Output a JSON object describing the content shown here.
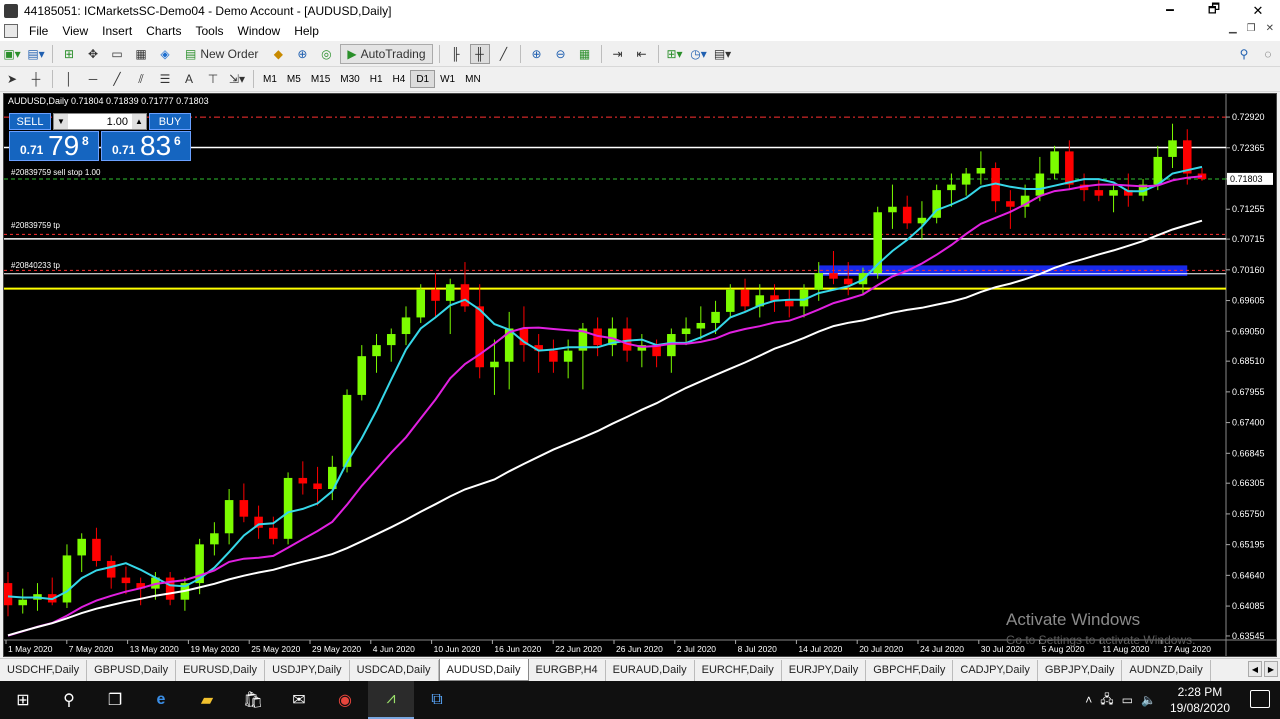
{
  "window": {
    "title": "44185051: ICMarketsSC-Demo04 - Demo Account - [AUDUSD,Daily]",
    "minimize": "🗕",
    "maximize": "🗗",
    "close": "✕"
  },
  "menu": {
    "items": [
      "File",
      "View",
      "Insert",
      "Charts",
      "Tools",
      "Window",
      "Help"
    ]
  },
  "toolbar": {
    "new_order_label": "New Order",
    "autotrading_label": "AutoTrading"
  },
  "drawing_tools": [
    "A"
  ],
  "timeframes": [
    "M1",
    "M5",
    "M15",
    "M30",
    "H1",
    "H4",
    "D1",
    "W1",
    "MN"
  ],
  "active_timeframe": "D1",
  "chart": {
    "symbol_line": "AUDUSD,Daily  0.71804 0.71839 0.71777 0.71803",
    "current_price": "0.71803",
    "colors": {
      "background": "#000000",
      "bull": "#7cfc00",
      "bear": "#ff0000",
      "ma_fast": "#36d7e8",
      "ma_mid": "#e020e0",
      "ma_slow": "#ffffff",
      "zone": "#1a2cff"
    }
  },
  "one_click": {
    "sell_label": "SELL",
    "buy_label": "BUY",
    "lot": "1.00",
    "sell_small": "0.71",
    "sell_big": "79",
    "sell_sup": "8",
    "buy_small": "0.71",
    "buy_big": "83",
    "buy_sup": "6"
  },
  "orders": [
    {
      "label": "#20839759 sell stop 1.00"
    },
    {
      "label": "#20839759 tp"
    },
    {
      "label": "#20840233 tp"
    }
  ],
  "watermark": {
    "line1": "Activate Windows",
    "line2": "Go to Settings to activate Windows."
  },
  "chart_data": {
    "type": "candlestick",
    "yticks": [
      "0.72920",
      "0.72365",
      "0.71803",
      "0.71255",
      "0.70715",
      "0.70160",
      "0.69605",
      "0.69050",
      "0.68510",
      "0.67955",
      "0.67400",
      "0.66845",
      "0.66305",
      "0.65750",
      "0.65195",
      "0.64640",
      "0.64085",
      "0.63545"
    ],
    "xticks": [
      "1 May 2020",
      "7 May 2020",
      "13 May 2020",
      "19 May 2020",
      "25 May 2020",
      "29 May 2020",
      "4 Jun 2020",
      "10 Jun 2020",
      "16 Jun 2020",
      "22 Jun 2020",
      "26 Jun 2020",
      "2 Jul 2020",
      "8 Jul 2020",
      "14 Jul 2020",
      "20 Jul 2020",
      "24 Jul 2020",
      "30 Jul 2020",
      "5 Aug 2020",
      "11 Aug 2020",
      "17 Aug 2020"
    ],
    "ylim": [
      0.6349,
      0.7312
    ],
    "ohlc": [
      [
        0.645,
        0.647,
        0.639,
        0.641
      ],
      [
        0.641,
        0.644,
        0.6395,
        0.642
      ],
      [
        0.642,
        0.645,
        0.64,
        0.643
      ],
      [
        0.643,
        0.646,
        0.641,
        0.6415
      ],
      [
        0.6415,
        0.652,
        0.6405,
        0.65
      ],
      [
        0.65,
        0.654,
        0.647,
        0.653
      ],
      [
        0.653,
        0.655,
        0.648,
        0.649
      ],
      [
        0.649,
        0.65,
        0.644,
        0.646
      ],
      [
        0.646,
        0.648,
        0.643,
        0.645
      ],
      [
        0.645,
        0.646,
        0.641,
        0.644
      ],
      [
        0.644,
        0.647,
        0.642,
        0.646
      ],
      [
        0.646,
        0.647,
        0.641,
        0.642
      ],
      [
        0.642,
        0.646,
        0.64,
        0.645
      ],
      [
        0.645,
        0.653,
        0.643,
        0.652
      ],
      [
        0.652,
        0.656,
        0.65,
        0.654
      ],
      [
        0.654,
        0.662,
        0.652,
        0.66
      ],
      [
        0.66,
        0.663,
        0.656,
        0.657
      ],
      [
        0.657,
        0.659,
        0.653,
        0.655
      ],
      [
        0.655,
        0.657,
        0.652,
        0.653
      ],
      [
        0.653,
        0.665,
        0.652,
        0.664
      ],
      [
        0.664,
        0.667,
        0.661,
        0.663
      ],
      [
        0.663,
        0.666,
        0.659,
        0.662
      ],
      [
        0.662,
        0.668,
        0.66,
        0.666
      ],
      [
        0.666,
        0.68,
        0.665,
        0.679
      ],
      [
        0.679,
        0.688,
        0.678,
        0.686
      ],
      [
        0.686,
        0.69,
        0.683,
        0.688
      ],
      [
        0.688,
        0.691,
        0.685,
        0.69
      ],
      [
        0.69,
        0.695,
        0.688,
        0.693
      ],
      [
        0.693,
        0.699,
        0.692,
        0.698
      ],
      [
        0.698,
        0.701,
        0.693,
        0.696
      ],
      [
        0.696,
        0.7,
        0.69,
        0.699
      ],
      [
        0.699,
        0.703,
        0.694,
        0.695
      ],
      [
        0.695,
        0.699,
        0.682,
        0.684
      ],
      [
        0.684,
        0.689,
        0.679,
        0.685
      ],
      [
        0.685,
        0.694,
        0.68,
        0.691
      ],
      [
        0.691,
        0.695,
        0.685,
        0.688
      ],
      [
        0.688,
        0.69,
        0.683,
        0.687
      ],
      [
        0.687,
        0.689,
        0.683,
        0.685
      ],
      [
        0.685,
        0.689,
        0.682,
        0.687
      ],
      [
        0.687,
        0.692,
        0.68,
        0.691
      ],
      [
        0.691,
        0.693,
        0.686,
        0.688
      ],
      [
        0.688,
        0.693,
        0.686,
        0.691
      ],
      [
        0.691,
        0.693,
        0.685,
        0.687
      ],
      [
        0.687,
        0.69,
        0.684,
        0.688
      ],
      [
        0.688,
        0.689,
        0.684,
        0.686
      ],
      [
        0.686,
        0.691,
        0.683,
        0.69
      ],
      [
        0.69,
        0.693,
        0.688,
        0.691
      ],
      [
        0.691,
        0.695,
        0.689,
        0.692
      ],
      [
        0.692,
        0.696,
        0.69,
        0.694
      ],
      [
        0.694,
        0.699,
        0.693,
        0.698
      ],
      [
        0.698,
        0.7,
        0.694,
        0.695
      ],
      [
        0.695,
        0.699,
        0.693,
        0.697
      ],
      [
        0.697,
        0.699,
        0.694,
        0.696
      ],
      [
        0.696,
        0.698,
        0.693,
        0.695
      ],
      [
        0.695,
        0.699,
        0.693,
        0.698
      ],
      [
        0.698,
        0.703,
        0.696,
        0.701
      ],
      [
        0.701,
        0.705,
        0.699,
        0.7
      ],
      [
        0.7,
        0.703,
        0.697,
        0.699
      ],
      [
        0.699,
        0.702,
        0.697,
        0.701
      ],
      [
        0.701,
        0.713,
        0.7,
        0.712
      ],
      [
        0.712,
        0.717,
        0.709,
        0.713
      ],
      [
        0.713,
        0.715,
        0.709,
        0.71
      ],
      [
        0.71,
        0.714,
        0.707,
        0.711
      ],
      [
        0.711,
        0.717,
        0.71,
        0.716
      ],
      [
        0.716,
        0.719,
        0.713,
        0.717
      ],
      [
        0.717,
        0.72,
        0.715,
        0.719
      ],
      [
        0.719,
        0.723,
        0.717,
        0.72
      ],
      [
        0.72,
        0.721,
        0.712,
        0.714
      ],
      [
        0.714,
        0.716,
        0.709,
        0.713
      ],
      [
        0.713,
        0.717,
        0.711,
        0.715
      ],
      [
        0.715,
        0.722,
        0.714,
        0.719
      ],
      [
        0.719,
        0.724,
        0.718,
        0.723
      ],
      [
        0.723,
        0.725,
        0.716,
        0.717
      ],
      [
        0.717,
        0.719,
        0.714,
        0.716
      ],
      [
        0.716,
        0.718,
        0.714,
        0.715
      ],
      [
        0.715,
        0.717,
        0.712,
        0.716
      ],
      [
        0.716,
        0.719,
        0.713,
        0.715
      ],
      [
        0.715,
        0.718,
        0.714,
        0.717
      ],
      [
        0.717,
        0.724,
        0.716,
        0.722
      ],
      [
        0.722,
        0.728,
        0.72,
        0.725
      ],
      [
        0.725,
        0.727,
        0.717,
        0.719
      ],
      [
        0.719,
        0.72,
        0.7177,
        0.718
      ]
    ]
  },
  "symbol_tabs": [
    "USDCHF,Daily",
    "GBPUSD,Daily",
    "EURUSD,Daily",
    "USDJPY,Daily",
    "USDCAD,Daily",
    "AUDUSD,Daily",
    "EURGBP,H4",
    "EURAUD,Daily",
    "EURCHF,Daily",
    "EURJPY,Daily",
    "GBPCHF,Daily",
    "CADJPY,Daily",
    "GBPJPY,Daily",
    "AUDNZD,Daily"
  ],
  "active_tab": "AUDUSD,Daily",
  "taskbar": {
    "time": "2:28 PM",
    "date": "19/08/2020"
  }
}
